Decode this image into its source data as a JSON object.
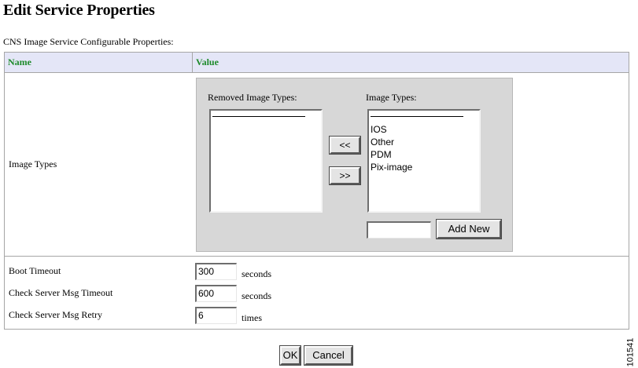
{
  "page": {
    "title": "Edit Service Properties",
    "subtitle": "CNS Image Service Configurable Properties:"
  },
  "table": {
    "header_name": "Name",
    "header_value": "Value",
    "header_color": "#1d8a2a"
  },
  "image_types": {
    "row_label": "Image Types",
    "removed_label": "Removed Image Types:",
    "removed_items": [],
    "active_label": "Image Types:",
    "active_items": [
      "IOS",
      "Other",
      "PDM",
      "Pix-image"
    ],
    "move_left_label": "<<",
    "move_right_label": ">>",
    "new_type_value": "",
    "add_new_label": "Add New"
  },
  "settings": {
    "boot_timeout_label": "Boot Timeout",
    "boot_timeout_value": "300",
    "boot_timeout_unit": "seconds",
    "msg_timeout_label": "Check Server Msg Timeout",
    "msg_timeout_value": "600",
    "msg_timeout_unit": "seconds",
    "msg_retry_label": "Check Server Msg Retry",
    "msg_retry_value": "6",
    "msg_retry_unit": "times"
  },
  "footer": {
    "ok_label": "OK",
    "cancel_label": "Cancel",
    "figure_code": "101541"
  }
}
